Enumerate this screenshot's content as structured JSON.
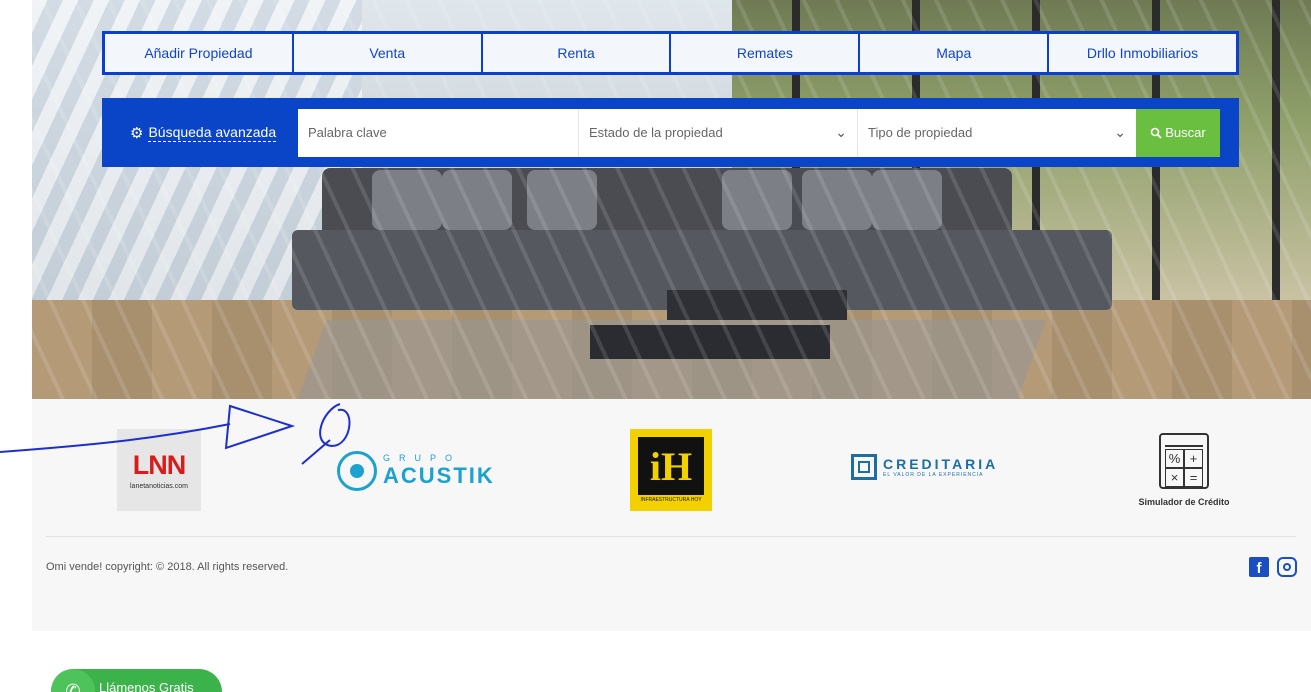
{
  "nav": {
    "tabs": [
      "Añadir Propiedad",
      "Venta",
      "Renta",
      "Remates",
      "Mapa",
      "Drllo Inmobiliarios"
    ]
  },
  "search": {
    "advanced_label": "Búsqueda avanzada",
    "keyword_placeholder": "Palabra clave",
    "status_select": "Estado de la propiedad",
    "type_select": "Tipo de propiedad",
    "button_label": "Buscar"
  },
  "partners": {
    "lnn_big": "LNN",
    "lnn_small": "lanetanoticias.com",
    "acustik_grupo": "GRUPO",
    "acustik_name": "ACUSTIK",
    "ih_logo": "iH",
    "ih_caption": "INFRAESTRUCTURA HOY",
    "creditaria_name": "CREDITARIA",
    "creditaria_tag": "EL VALOR DE LA EXPERIENCIA",
    "simulador_label": "Simulador de Crédito"
  },
  "footer": {
    "copyright": "Omi vende! copyright: © 2018. All rights reserved."
  },
  "call": {
    "label": "Llámenos Gratis"
  },
  "colors": {
    "primary_blue": "#0a45c8",
    "search_button": "#6abf40",
    "call_green": "#3bb24a"
  }
}
